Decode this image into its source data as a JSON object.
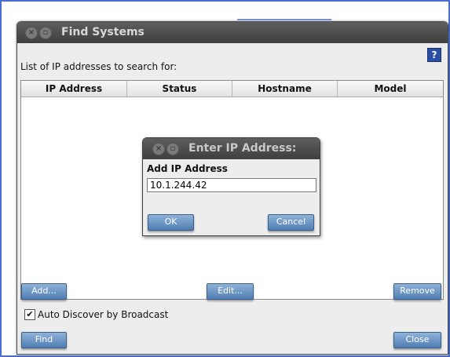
{
  "window": {
    "title": "Find Systems",
    "list_label": "List of IP addresses to search for:",
    "help_icon": "?",
    "table": {
      "columns": [
        "IP Address",
        "Status",
        "Hostname",
        "Model"
      ],
      "rows": []
    },
    "buttons": {
      "add": "Add...",
      "edit": "Edit...",
      "remove": "Remove",
      "find": "Find",
      "close": "Close"
    },
    "auto_discover": {
      "label": "Auto Discover by Broadcast",
      "checked": true
    }
  },
  "dialog": {
    "title": "Enter IP Address:",
    "heading": "Add IP Address",
    "input_value": "10.1.244.42",
    "ok": "OK",
    "cancel": "Cancel"
  },
  "colors": {
    "accent": "#4f7db2",
    "titlebar": "#4a4a4a",
    "frame_border": "#4a6cd4"
  }
}
